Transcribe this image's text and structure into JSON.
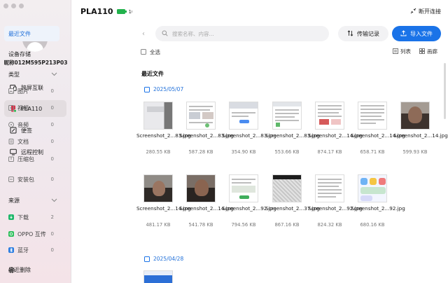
{
  "window": {
    "controls": [
      "close",
      "minimize",
      "zoom"
    ]
  },
  "user": {
    "nickname": "昵称012M595P213P03"
  },
  "left_nav": [
    {
      "label": "跨屏互联",
      "icon": "screens-icon",
      "active": false
    },
    {
      "label": "PLA110",
      "icon": "phone-icon",
      "active": true
    },
    {
      "label": "便签",
      "icon": "note-icon",
      "active": false
    },
    {
      "label": "远程控制",
      "icon": "remote-control-icon",
      "active": false
    }
  ],
  "device": {
    "name": "PLA110",
    "battery": "100%",
    "battery_level": 1.0,
    "battery_color": "#22b24c"
  },
  "middle": {
    "recent": "最近文件",
    "storage": "设备存储",
    "types_title": "类型",
    "types": [
      {
        "label": "图片",
        "count": "0"
      },
      {
        "label": "视频",
        "count": "0"
      },
      {
        "label": "音频",
        "count": "0"
      },
      {
        "label": "文档",
        "count": "0"
      },
      {
        "label": "压缩包",
        "count": "0"
      },
      {
        "label": "安装包",
        "count": "0"
      }
    ],
    "sources_title": "来源",
    "sources": [
      {
        "label": "下载",
        "count": "2",
        "color": "#1fb86a"
      },
      {
        "label": "OPPO 互传",
        "count": "0",
        "color": "#2bbf5a"
      },
      {
        "label": "蓝牙",
        "count": "0",
        "color": "#2a7de1"
      }
    ],
    "deleted": "最近删除"
  },
  "header": {
    "disconnect": "断开连接",
    "search_placeholder": "搜索名称、内容...",
    "transfer_log": "传输记录",
    "import_file": "导入文件",
    "accent": "#1a73e8"
  },
  "toolbar": {
    "select_all": "全选",
    "list": "列表",
    "gallery": "画廊"
  },
  "section_title": "最近文件",
  "groups": [
    {
      "date": "2025/05/07",
      "files": [
        {
          "name": "Screenshot_2...83.jpg",
          "size": "280.55 KB"
        },
        {
          "name": "Screenshot_2...83.jpg",
          "size": "587.28 KB"
        },
        {
          "name": "Screenshot_2...83.jpg",
          "size": "354.90 KB"
        },
        {
          "name": "Screenshot_2...83.jpg",
          "size": "553.66 KB"
        },
        {
          "name": "Screenshot_2...14.jpg",
          "size": "874.17 KB"
        },
        {
          "name": "Screenshot_2...14.jpg",
          "size": "658.71 KB"
        },
        {
          "name": "Screenshot_2...14.jpg",
          "size": "599.93 KB"
        },
        {
          "name": "Screenshot_2...14.jpg",
          "size": "481.17 KB"
        },
        {
          "name": "Screenshot_2...14.jpg",
          "size": "541.78 KB"
        },
        {
          "name": "Screenshot_2...92.jpg",
          "size": "794.56 KB"
        },
        {
          "name": "Screenshot_2...37.jpg",
          "size": "867.16 KB"
        },
        {
          "name": "Screenshot_2...92.jpg",
          "size": "824.32 KB"
        },
        {
          "name": "Screenshot_2...92.jpg",
          "size": "680.16 KB"
        }
      ]
    },
    {
      "date": "2025/04/28",
      "files": []
    }
  ]
}
